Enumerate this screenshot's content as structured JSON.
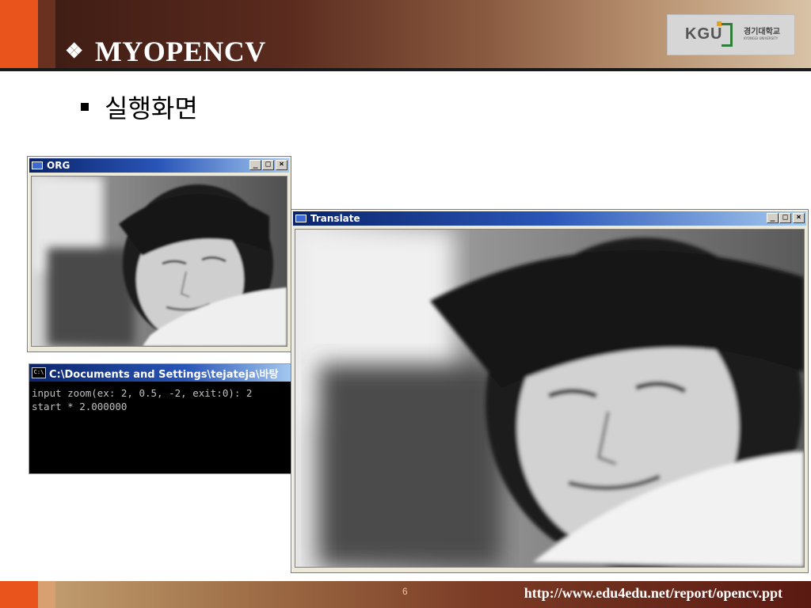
{
  "slide": {
    "title": "MYOPENCV",
    "bullet": "실행화면",
    "page_number": "6",
    "footer_url": "http://www.edu4edu.net/report/opencv.ppt"
  },
  "logo": {
    "mark": "KGU",
    "name": "경기대학교",
    "name_en": "KYONGGI UNIVERSITY"
  },
  "windows": {
    "org": {
      "title": "ORG"
    },
    "translate": {
      "title": "Translate"
    },
    "buttons": {
      "minimize": "_",
      "maximize": "□",
      "close": "×"
    }
  },
  "console": {
    "icon_label": "C:\\",
    "title": "C:\\Documents and Settings\\tejateja\\바탕",
    "lines": [
      "input zoom(ex: 2, 0.5, -2, exit:0): 2",
      "start * 2.000000"
    ]
  },
  "colors": {
    "accent_orange": "#e8541c",
    "title_bar": "#0a246a"
  }
}
